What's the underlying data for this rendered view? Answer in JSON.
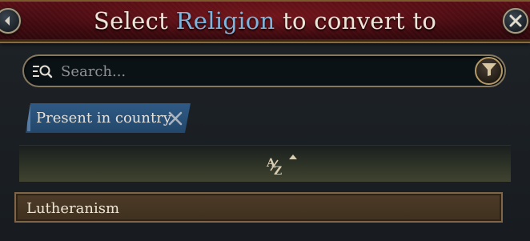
{
  "header": {
    "title_prefix": "Select",
    "title_highlight": "Religion",
    "title_suffix": "to convert to"
  },
  "search": {
    "placeholder": "Search...",
    "value": ""
  },
  "filters": {
    "active": [
      {
        "label": "Present in country"
      }
    ]
  },
  "list": {
    "items": [
      {
        "label": "Lutheranism"
      }
    ]
  },
  "icons": {
    "back": "back-arrow-icon",
    "close": "close-icon",
    "search": "search-list-icon",
    "filter": "funnel-icon",
    "remove_filter": "x-icon",
    "sort": "sort-alphabetical-ascending-icon"
  },
  "colors": {
    "header_bg": "#4a0d14",
    "title_highlight": "#7fb5dc",
    "chip_bg": "#2a5079",
    "list_item_bg": "#463624",
    "border_gold": "#86785f"
  }
}
